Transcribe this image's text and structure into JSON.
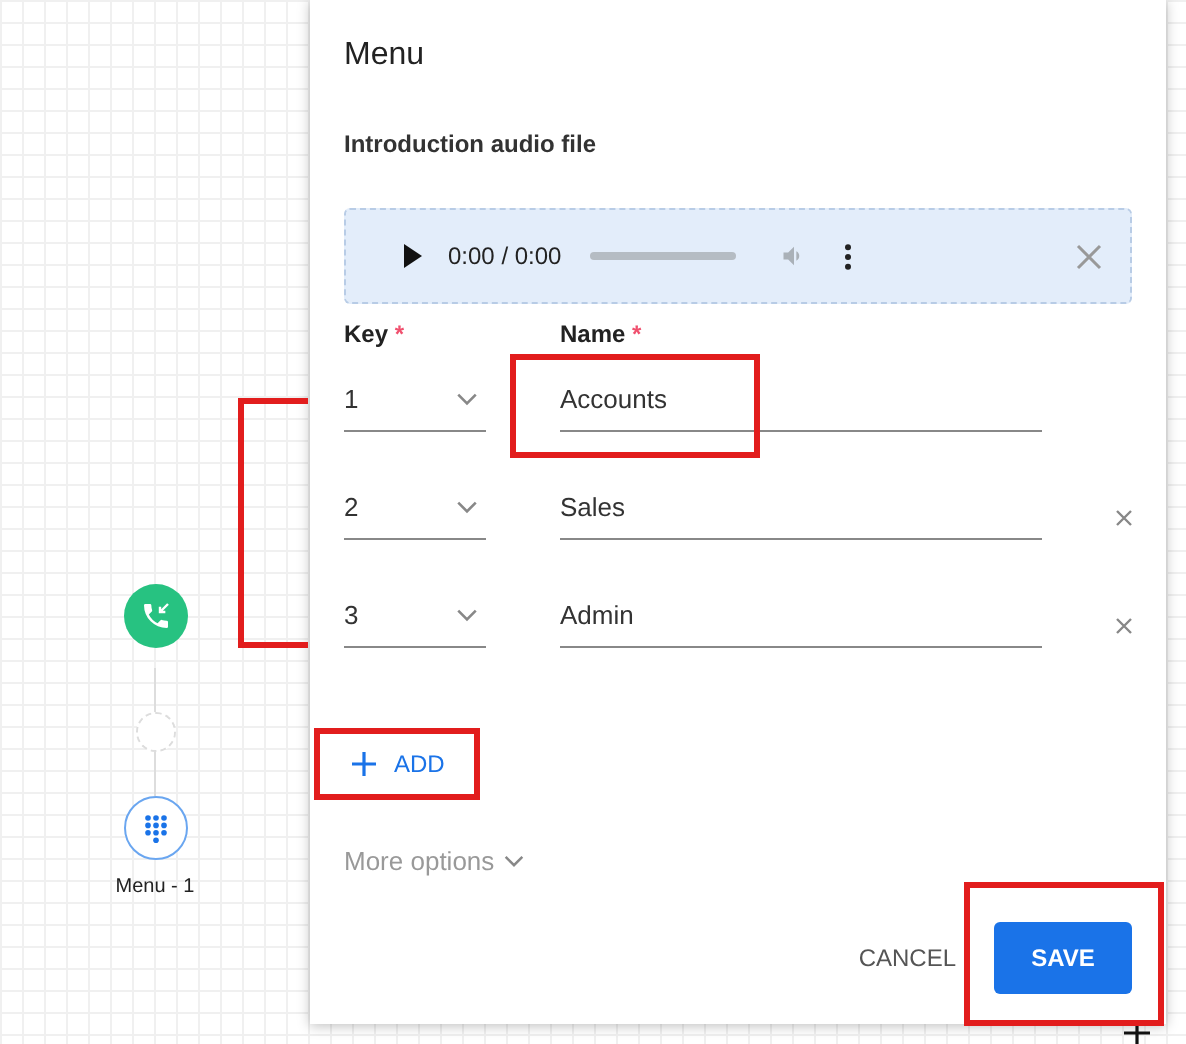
{
  "canvas": {
    "nodes": [
      {
        "kind": "call"
      },
      {
        "kind": "placeholder"
      },
      {
        "kind": "menu",
        "label": "Menu - 1"
      }
    ]
  },
  "panel": {
    "title": "Menu",
    "audio": {
      "label": "Introduction audio file",
      "time": "0:00 / 0:00"
    },
    "columns": [
      {
        "label": "Key",
        "required_mark": "*"
      },
      {
        "label": "Name",
        "required_mark": "*"
      }
    ],
    "rows": [
      {
        "key": "1",
        "name": "Accounts",
        "removable": false
      },
      {
        "key": "2",
        "name": "Sales",
        "removable": true
      },
      {
        "key": "3",
        "name": "Admin",
        "removable": true
      }
    ],
    "add_button": "ADD",
    "more_options": "More options",
    "buttons": [
      {
        "label": "CANCEL",
        "kind": "text"
      },
      {
        "label": "SAVE",
        "kind": "primary"
      }
    ]
  }
}
